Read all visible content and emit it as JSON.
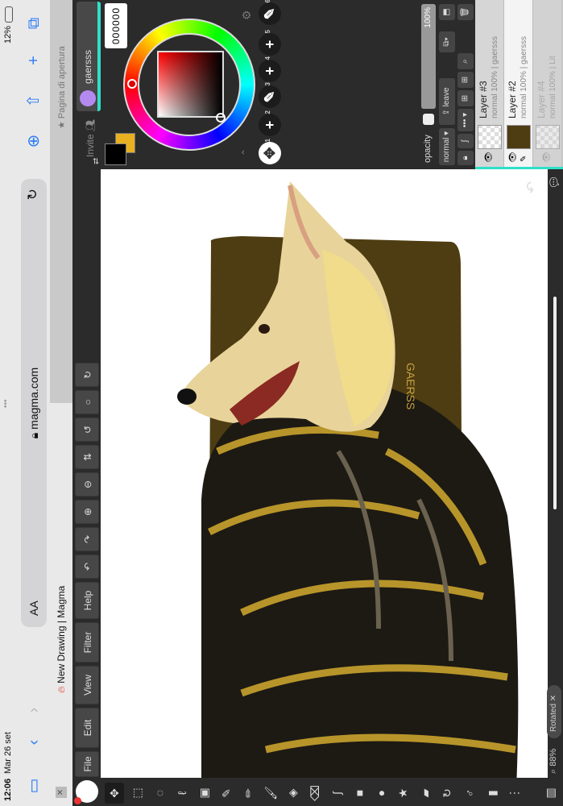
{
  "status": {
    "time": "12:06",
    "date": "Mar 26 set",
    "battery": "12%"
  },
  "browser": {
    "address": "magma.com",
    "text_size": "AA",
    "dots": "•••",
    "tabs": [
      {
        "label": "New Drawing | Magma",
        "active": true
      },
      {
        "label": "Pagina di apertura",
        "active": false
      }
    ]
  },
  "menu": {
    "items": [
      "File",
      "Edit",
      "View",
      "Filter",
      "Help"
    ]
  },
  "toolbar_icons": [
    "undo",
    "redo",
    "zoom-in",
    "zoom-out",
    "flip",
    "rotate-left",
    "reset-rotation",
    "rotate-right"
  ],
  "tools": [
    "move",
    "rect-select",
    "ellipse-select",
    "lasso",
    "transform",
    "eyedropper",
    "pencil",
    "brush",
    "paint-bucket",
    "eraser",
    "smudge",
    "rectangle",
    "ellipse",
    "star",
    "text",
    "rotate",
    "magnify",
    "paper",
    "more"
  ],
  "user": {
    "invite": "Invite",
    "name": "gaersss"
  },
  "color": {
    "hex": "000000",
    "primary": "#000000",
    "secondary": "#e8b020"
  },
  "brushes": [
    {
      "n": "1",
      "kind": "move"
    },
    {
      "n": "2",
      "kind": "add"
    },
    {
      "n": "3",
      "kind": "brush"
    },
    {
      "n": "4",
      "kind": "add"
    },
    {
      "n": "5",
      "kind": "add"
    },
    {
      "n": "6",
      "kind": "brush"
    }
  ],
  "layers_panel": {
    "opacity_label": "opacity",
    "opacity_value": "100%",
    "opacity": 1.0,
    "blend": "normal ▾",
    "leave": "leave",
    "more": "••• ▾",
    "layers": [
      {
        "name": "Layer #3",
        "sub": "normal 100% | gaersss"
      },
      {
        "name": "Layer #2",
        "sub": "normal 100% | gaersss",
        "selected": true
      },
      {
        "name": "Layer #4",
        "sub": "normal 100% | Lit",
        "faded": true
      }
    ]
  },
  "canvas": {
    "zoom": "88%",
    "rotated": "Rotated",
    "accent": "#2fe0c8"
  }
}
